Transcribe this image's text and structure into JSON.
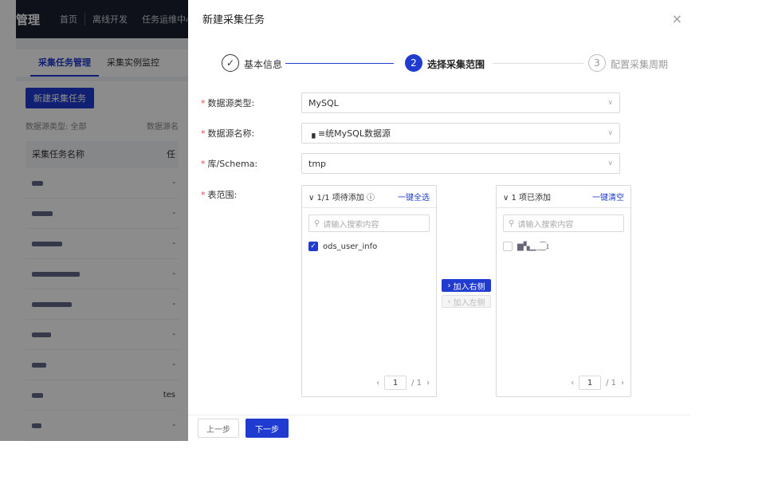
{
  "bg": {
    "brand": "管理",
    "nav": [
      "首页",
      "离线开发",
      "任务运维中心"
    ],
    "tabs": [
      "采集任务管理",
      "采集实例监控"
    ],
    "new_btn": "新建采集任务",
    "filter_left": "数据源类型: 全部",
    "filter_right": "数据源名",
    "table_header": "采集任务名称",
    "table_header_col2": "任",
    "row_dash": "-",
    "row_tes": "tes"
  },
  "dialog": {
    "title": "新建采集任务",
    "close": "×",
    "steps": [
      {
        "num": "✓",
        "label": "基本信息",
        "state": "done"
      },
      {
        "num": "2",
        "label": "选择采集范围",
        "state": "active"
      },
      {
        "num": "3",
        "label": "配置采集周期",
        "state": "pending"
      }
    ],
    "fields": {
      "source_type_label": "数据源类型:",
      "source_type_value": "MySQL",
      "source_name_label": "数据源名称:",
      "source_name_value": "▗ ≡统MySQL数据源",
      "schema_label": "库/Schema:",
      "schema_value": "tmp",
      "range_label": "表范围:"
    },
    "left_panel": {
      "count": "∨ 1/1 项待添加 ⓘ",
      "action": "一键全选",
      "search_placeholder": "请输入搜索内容",
      "items": [
        "ods_user_info"
      ],
      "page": "1",
      "total": "/ 1"
    },
    "right_panel": {
      "count": "∨ 1 项已添加",
      "action": "一键清空",
      "search_placeholder": "请输入搜索内容",
      "items": [
        "▆▚▁_⁐ɪ"
      ],
      "page": "1",
      "total": "/ 1"
    },
    "move_right": "加入右侧",
    "move_left": "加入左侧",
    "prev": "上一步",
    "next": "下一步"
  },
  "colors": {
    "primary": "#1f3bd0",
    "required": "#e34d4d"
  }
}
